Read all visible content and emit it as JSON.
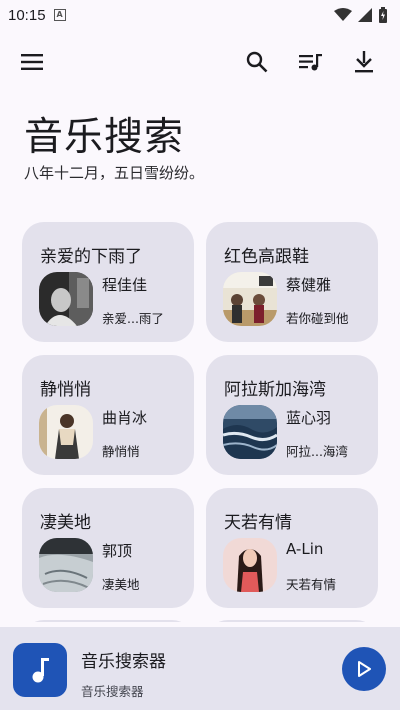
{
  "status_bar": {
    "time": "10:15",
    "badge": "A"
  },
  "toolbar": {
    "menu": "menu-icon",
    "search": "search-icon",
    "playlist": "playlist-icon",
    "download": "download-icon"
  },
  "header": {
    "title": "音乐搜索",
    "subtitle": "八年十二月，五日雪纷纷。"
  },
  "cards": [
    {
      "title": "亲爱的下雨了",
      "artist": "程佳佳",
      "song": "亲爱...雨了"
    },
    {
      "title": "红色高跟鞋",
      "artist": "蔡健雅",
      "song": "若你碰到他"
    },
    {
      "title": "静悄悄",
      "artist": "曲肖冰",
      "song": "静悄悄"
    },
    {
      "title": "阿拉斯加海湾",
      "artist": "蓝心羽",
      "song": "阿拉...海湾"
    },
    {
      "title": "凄美地",
      "artist": "郭顶",
      "song": "凄美地"
    },
    {
      "title": "天若有情",
      "artist": "A-Lin",
      "song": "天若有情"
    }
  ],
  "player": {
    "title": "音乐搜索器",
    "subtitle": "音乐搜索器"
  },
  "colors": {
    "background": "#fbf8fd",
    "card": "#e3e1ec",
    "accent": "#1f54b6",
    "player_bar": "#e4e3ee"
  }
}
